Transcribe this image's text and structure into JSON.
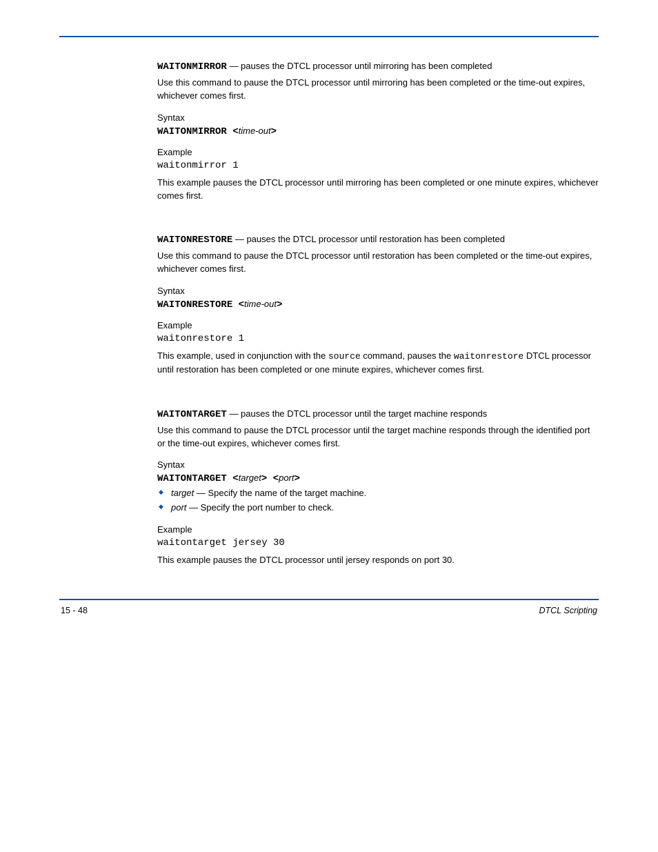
{
  "sections": [
    {
      "cmd": "WAITONMIRROR",
      "lead_plain": " — pauses the DTCL processor until mirroring has been completed",
      "desc": "Use this command to pause the DTCL processor until mirroring has been completed or the time-out expires, whichever comes first.",
      "syntax_label": "Syntax",
      "syntax_cmd": "WAITONMIRROR <",
      "syntax_arg": "time-out",
      "syntax_close": ">",
      "example_label": "Example",
      "example_code": "waitonmirror 1",
      "explain": "This example pauses the DTCL processor until mirroring has been completed or one minute expires, whichever comes first."
    },
    {
      "cmd": "WAITONRESTORE",
      "lead_plain": " — pauses the DTCL processor until restoration has been completed",
      "desc": "Use this command to pause the DTCL processor until restoration has been completed or the time-out expires, whichever comes first.",
      "syntax_label": "Syntax",
      "syntax_cmd": "WAITONRESTORE <",
      "syntax_arg": "time-out",
      "syntax_close": ">",
      "example_label": "Example",
      "example_code": "waitonrestore 1",
      "explain_pre": "This example, used in conjunction with the ",
      "explain_mono1": "source",
      "explain_mid": " command, pauses the ",
      "explain_mono2": "waitonrestore",
      "explain_post": " DTCL processor until restoration has been completed or one minute expires, whichever comes first."
    },
    {
      "cmd": "WAITONTARGET",
      "lead_plain": " — pauses the DTCL processor until the target machine responds",
      "desc": "Use this command to pause the DTCL processor until the target machine responds through the identified port or the time-out expires, whichever comes first.",
      "syntax_label": "Syntax",
      "syntax_cmd": "WAITONTARGET <",
      "syntax_arg1": "target",
      "syntax_mid": "> <",
      "syntax_arg2": "port",
      "syntax_close": ">",
      "bullets": [
        {
          "term": "target",
          "body": " — Specify the name of the target machine."
        },
        {
          "term": "port",
          "body": " — Specify the port number to check."
        }
      ],
      "example_label": "Example",
      "example_code": "waitontarget jersey 30",
      "explain": "This example pauses the DTCL processor until jersey responds on port 30."
    }
  ],
  "footer": {
    "page": "15 - 48",
    "title": "DTCL Scripting"
  }
}
